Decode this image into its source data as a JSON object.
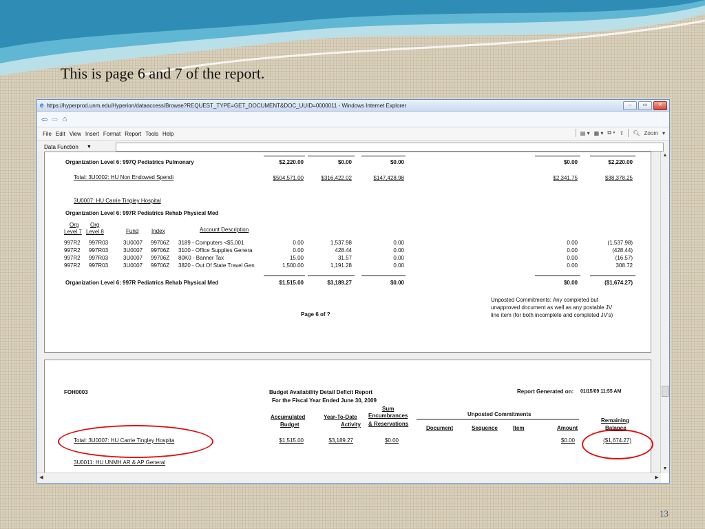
{
  "slide": {
    "title": "This is page 6 and 7 of the report.",
    "number": "13"
  },
  "browser": {
    "title": "https://hyperprod.unm.edu/Hyperion/dataaccess/Browse?REQUEST_TYPE=GET_DOCUMENT&DOC_UUID=0000011 - Windows Internet Explorer",
    "menu": [
      "File",
      "Edit",
      "View",
      "Insert",
      "Format",
      "Report",
      "Tools",
      "Help"
    ],
    "zoom_label": "Zoom",
    "data_function_label": "Data Function"
  },
  "page1": {
    "org_997q_label": "Organization Level 6: 997Q Pediatrics Pulmonary",
    "org_997q_values": [
      "$2,220.00",
      "$0.00",
      "$0.00",
      "$0.00",
      "$2,220.00"
    ],
    "total_3u0002_label": "Total: 3U0002: HU Non Endowed Spendi",
    "total_3u0002_values": [
      "$504,571.00",
      "$316,422.02",
      "$147,428.98",
      "$2,341.75",
      "$38,378.25"
    ],
    "fund_3u0007_label": "3U0007: HU Carrie Tingley Hospital",
    "org_997r_header": "Organization Level 6: 997R Pediatrics Rehab Physical Med",
    "col_headers": {
      "org_l7_top": "Org",
      "org_l7_bottom": "Level 7",
      "org_l8_top": "Org",
      "org_l8_bottom": "Level 8",
      "fund": "Fund",
      "index": "Index",
      "account_desc": "Account Description"
    },
    "rows": [
      {
        "l7": "997R2",
        "l8": "997R03",
        "fund": "3U0007",
        "index": "99706Z",
        "desc": "3189 - Computers <$5,001",
        "budget": "0.00",
        "ytd": "1,537.98",
        "enc": "0.00",
        "amount": "0.00",
        "balance": "(1,537.98)"
      },
      {
        "l7": "997R2",
        "l8": "997R03",
        "fund": "3U0007",
        "index": "99706Z",
        "desc": "3100 - Office Supplies Genera",
        "budget": "0.00",
        "ytd": "428.44",
        "enc": "0.00",
        "amount": "0.00",
        "balance": "(428.44)"
      },
      {
        "l7": "997R2",
        "l8": "997R03",
        "fund": "3U0007",
        "index": "99706Z",
        "desc": "80K0 - Banner Tax",
        "budget": "15.00",
        "ytd": "31.57",
        "enc": "0.00",
        "amount": "0.00",
        "balance": "(16.57)"
      },
      {
        "l7": "997R2",
        "l8": "997R03",
        "fund": "3U0007",
        "index": "99706Z",
        "desc": "3820 - Out Of State Travel Gen",
        "budget": "1,500.00",
        "ytd": "1,191.28",
        "enc": "0.00",
        "amount": "0.00",
        "balance": "308.72"
      }
    ],
    "org_997r_total_label": "Organization Level 6: 997R Pediatrics Rehab Physical Med",
    "org_997r_total_values": [
      "$1,515.00",
      "$3,189.27",
      "$0.00",
      "$0.00",
      "($1,674.27)"
    ],
    "unposted_note": [
      "Unposted Commitments: Any completed but",
      "unapproved document as well as any postable JV",
      "line item (for both incomplete and completed JV's)"
    ],
    "page_label": "Page 6 of ?"
  },
  "page2": {
    "report_id": "FOH0003",
    "report_title": "Budget Availability Detail Deficit Report",
    "report_subtitle": "For the Fiscal Year Ended June 30, 2009",
    "generated_label": "Report Generated on:",
    "generated_value": "01/15/09 11:55 AM",
    "headers": {
      "accum_top": "Accumulated",
      "accum_bottom": "Budget",
      "ytd_top": "Year-To-Date",
      "ytd_bottom": "Activity",
      "sum_1": "Sum",
      "sum_2": "Encumbrances",
      "sum_3": "& Reservations",
      "unposted": "Unposted Commitments",
      "document": "Document",
      "sequence": "Sequence",
      "item": "Item",
      "amount": "Amount",
      "remaining_top": "Remaining",
      "remaining_bottom": "Balance"
    },
    "total_3u0007_label": "Total: 3U0007: HU Carrie Tingley Hospita",
    "total_3u0007_values": [
      "$1,515.00",
      "$3,189.27",
      "$0.00",
      "$0.00",
      "($1,674.27)"
    ],
    "fund_3u0011_label": "3U0011: HU UNMH AR & AP General"
  },
  "colors": {
    "highlight": "#e01010",
    "wave": "#3aa3c8"
  }
}
